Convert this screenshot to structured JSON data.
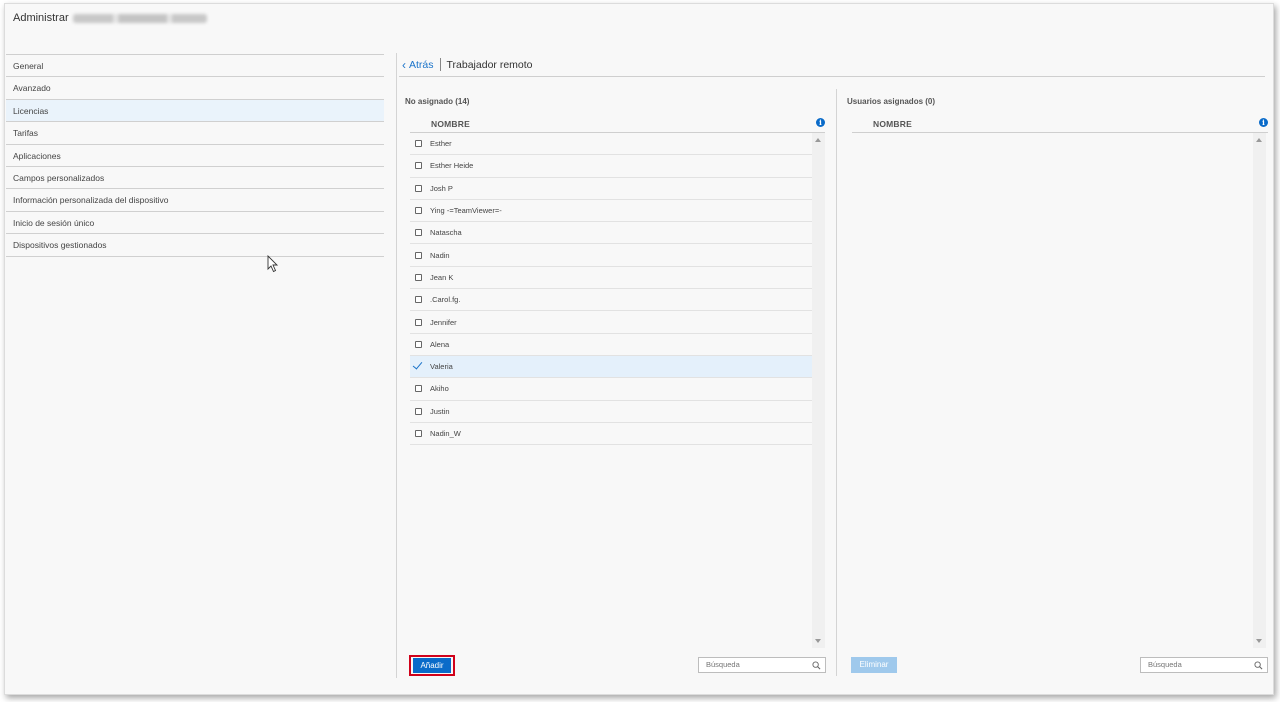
{
  "header": {
    "title": "Administrar"
  },
  "sidebar": {
    "items": [
      {
        "label": "General"
      },
      {
        "label": "Avanzado"
      },
      {
        "label": "Licencias"
      },
      {
        "label": "Tarifas"
      },
      {
        "label": "Aplicaciones"
      },
      {
        "label": "Campos personalizados"
      },
      {
        "label": "Información personalizada del dispositivo"
      },
      {
        "label": "Inicio de sesión único"
      },
      {
        "label": "Dispositivos gestionados"
      }
    ],
    "active_index": 2
  },
  "main": {
    "back_label": "Atrás",
    "page_title": "Trabajador remoto"
  },
  "unassigned": {
    "title": "No asignado (14)",
    "column_header": "NOMBRE",
    "users": [
      {
        "name": "Esther",
        "checked": false
      },
      {
        "name": "Esther Heide",
        "checked": false
      },
      {
        "name": "Josh P",
        "checked": false
      },
      {
        "name": "Ying -=TeamViewer=-",
        "checked": false
      },
      {
        "name": "Natascha",
        "checked": false
      },
      {
        "name": "Nadin",
        "checked": false
      },
      {
        "name": "Jean K",
        "checked": false
      },
      {
        "name": ".Carol.fg.",
        "checked": false
      },
      {
        "name": "Jennifer",
        "checked": false
      },
      {
        "name": "Alena",
        "checked": false
      },
      {
        "name": "Valeria",
        "checked": true
      },
      {
        "name": "Akiho",
        "checked": false
      },
      {
        "name": "Justin",
        "checked": false
      },
      {
        "name": "Nadin_W",
        "checked": false
      }
    ],
    "add_label": "Añadir",
    "search_placeholder": "Búsqueda"
  },
  "assigned": {
    "title": "Usuarios asignados (0)",
    "column_header": "NOMBRE",
    "users": [],
    "remove_label": "Eliminar",
    "search_placeholder": "Búsqueda"
  },
  "colors": {
    "accent": "#0a6bc9",
    "selected_row": "#e4f0fb",
    "highlight_border": "#d0021b",
    "disabled_button": "#9fc9ec"
  },
  "icons": {
    "back": "chevron-left-icon",
    "info": "info-icon",
    "search": "search-icon",
    "cursor": "mouse-pointer-icon"
  }
}
